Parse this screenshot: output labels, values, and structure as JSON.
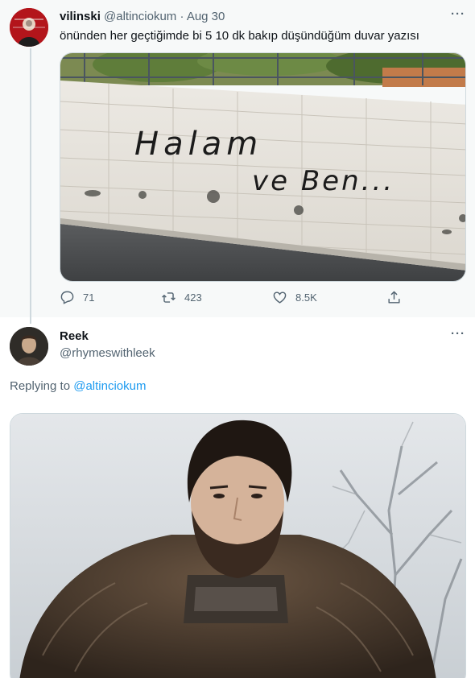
{
  "tweet1": {
    "display_name": "vilinski",
    "handle": "@altinciokum",
    "separator": "·",
    "date": "Aug 30",
    "text": "önünden her geçtiğimde bi 5 10 dk bakıp düşündüğüm duvar yazısı",
    "graffiti_line1": "Halam",
    "graffiti_line2": "ve Ben...",
    "more_icon": "more-dots-icon",
    "stats": {
      "replies": "71",
      "retweets": "423",
      "likes": "8.5K"
    }
  },
  "tweet2": {
    "display_name": "Reek",
    "handle": "@rhymeswithleek",
    "replying_prefix": "Replying to",
    "replying_to": "@altinciokum",
    "more_icon": "more-dots-icon"
  },
  "colors": {
    "text_primary": "#0f1419",
    "text_secondary": "#536471",
    "link": "#1d9bf0",
    "highlight_bg": "#f7f9f9"
  }
}
